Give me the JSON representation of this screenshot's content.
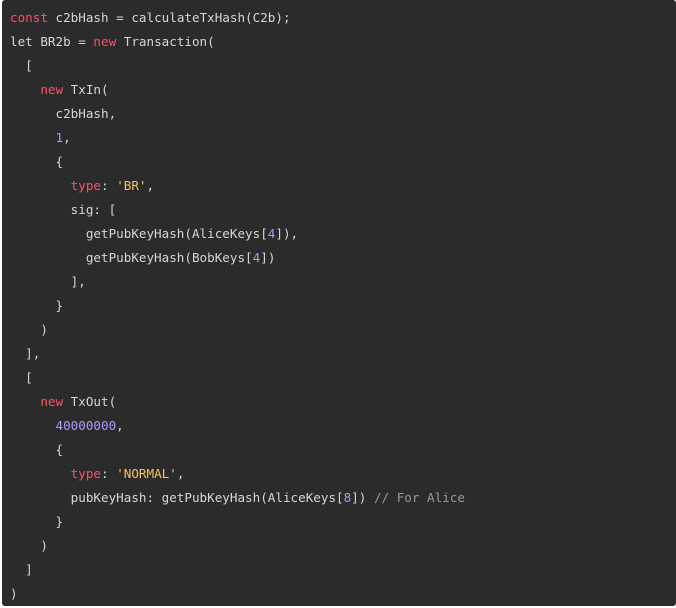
{
  "code_lines": [
    [
      {
        "t": "kw",
        "v": "const"
      },
      {
        "t": "txt",
        "v": " c2bHash = calculateTxHash(C2b);"
      }
    ],
    [
      {
        "t": "txt",
        "v": "let BR2b = "
      },
      {
        "t": "kw",
        "v": "new"
      },
      {
        "t": "txt",
        "v": " Transaction("
      }
    ],
    [
      {
        "t": "txt",
        "v": "  ["
      }
    ],
    [
      {
        "t": "txt",
        "v": "    "
      },
      {
        "t": "kw",
        "v": "new"
      },
      {
        "t": "txt",
        "v": " TxIn("
      }
    ],
    [
      {
        "t": "txt",
        "v": "      c2bHash,"
      }
    ],
    [
      {
        "t": "txt",
        "v": "      "
      },
      {
        "t": "num",
        "v": "1"
      },
      {
        "t": "txt",
        "v": ","
      }
    ],
    [
      {
        "t": "txt",
        "v": "      {"
      }
    ],
    [
      {
        "t": "txt",
        "v": "        "
      },
      {
        "t": "prop",
        "v": "type"
      },
      {
        "t": "txt",
        "v": ": "
      },
      {
        "t": "str",
        "v": "'BR'"
      },
      {
        "t": "txt",
        "v": ","
      }
    ],
    [
      {
        "t": "txt",
        "v": "        sig: ["
      }
    ],
    [
      {
        "t": "txt",
        "v": "          getPubKeyHash(AliceKeys["
      },
      {
        "t": "num",
        "v": "4"
      },
      {
        "t": "txt",
        "v": "]),"
      }
    ],
    [
      {
        "t": "txt",
        "v": "          getPubKeyHash(BobKeys["
      },
      {
        "t": "num",
        "v": "4"
      },
      {
        "t": "txt",
        "v": "])"
      }
    ],
    [
      {
        "t": "txt",
        "v": "        ],"
      }
    ],
    [
      {
        "t": "txt",
        "v": "      }"
      }
    ],
    [
      {
        "t": "txt",
        "v": "    )"
      }
    ],
    [
      {
        "t": "txt",
        "v": "  ],"
      }
    ],
    [
      {
        "t": "txt",
        "v": "  ["
      }
    ],
    [
      {
        "t": "txt",
        "v": "    "
      },
      {
        "t": "kw",
        "v": "new"
      },
      {
        "t": "txt",
        "v": " TxOut("
      }
    ],
    [
      {
        "t": "txt",
        "v": "      "
      },
      {
        "t": "num",
        "v": "40000000"
      },
      {
        "t": "txt",
        "v": ","
      }
    ],
    [
      {
        "t": "txt",
        "v": "      {"
      }
    ],
    [
      {
        "t": "txt",
        "v": "        "
      },
      {
        "t": "prop",
        "v": "type"
      },
      {
        "t": "txt",
        "v": ": "
      },
      {
        "t": "str",
        "v": "'NORMAL'"
      },
      {
        "t": "txt",
        "v": ","
      }
    ],
    [
      {
        "t": "txt",
        "v": "        pubKeyHash: getPubKeyHash(AliceKeys["
      },
      {
        "t": "num",
        "v": "8"
      },
      {
        "t": "txt",
        "v": "]) "
      },
      {
        "t": "cmt",
        "v": "// For Alice"
      }
    ],
    [
      {
        "t": "txt",
        "v": "      }"
      }
    ],
    [
      {
        "t": "txt",
        "v": "    )"
      }
    ],
    [
      {
        "t": "txt",
        "v": "  ]"
      }
    ],
    [
      {
        "t": "txt",
        "v": ")"
      }
    ]
  ],
  "colors": {
    "background": "#2b2b2b",
    "keyword": "#ff4f6d",
    "number": "#b594ff",
    "string": "#f7c35b",
    "comment": "#9a9a9a",
    "text": "#d6d6d6"
  }
}
